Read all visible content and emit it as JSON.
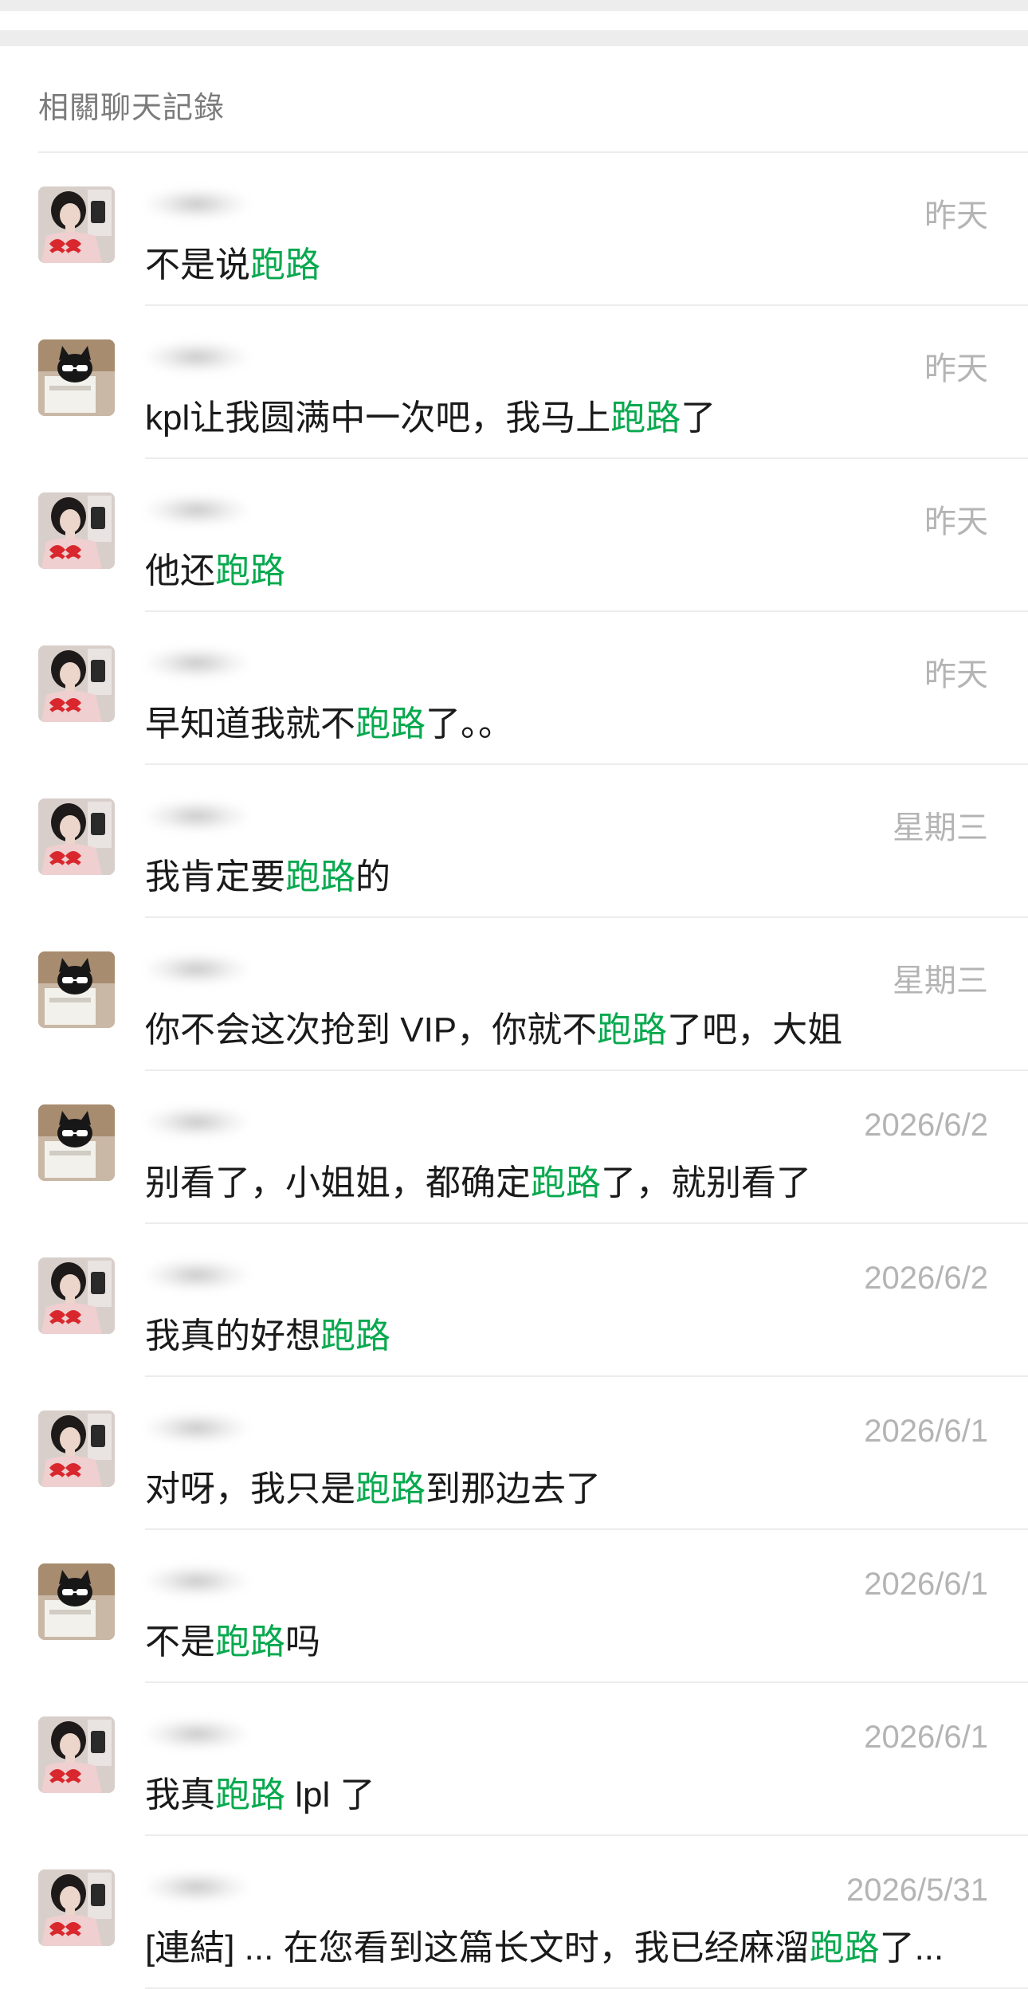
{
  "section": {
    "title": "相關聊天記錄"
  },
  "colors": {
    "highlight": "#07a94e",
    "date": "#b4b4b4",
    "text": "#1a1a1a"
  },
  "items": [
    {
      "avatar": "girl-avatar-icon",
      "date": "昨天",
      "before": "不是说",
      "keyword": "跑路",
      "after": ""
    },
    {
      "avatar": "cat-avatar-icon",
      "date": "昨天",
      "before": "kpl让我圆满中一次吧，我马上",
      "keyword": "跑路",
      "after": "了"
    },
    {
      "avatar": "girl-avatar-icon",
      "date": "昨天",
      "before": "他还",
      "keyword": "跑路",
      "after": ""
    },
    {
      "avatar": "girl-avatar-icon",
      "date": "昨天",
      "before": "早知道我就不",
      "keyword": "跑路",
      "after": "了。。"
    },
    {
      "avatar": "girl-avatar-icon",
      "date": "星期三",
      "before": "我肯定要",
      "keyword": "跑路",
      "after": "的"
    },
    {
      "avatar": "cat-avatar-icon",
      "date": "星期三",
      "before": "你不会这次抢到 VIP，你就不",
      "keyword": "跑路",
      "after": "了吧，大姐"
    },
    {
      "avatar": "cat-avatar-icon",
      "date": "2026/6/2",
      "before": "别看了，小姐姐，都确定",
      "keyword": "跑路",
      "after": "了，就别看了"
    },
    {
      "avatar": "girl-avatar-icon",
      "date": "2026/6/2",
      "before": "我真的好想",
      "keyword": "跑路",
      "after": ""
    },
    {
      "avatar": "girl-avatar-icon",
      "date": "2026/6/1",
      "before": "对呀，我只是",
      "keyword": "跑路",
      "after": "到那边去了"
    },
    {
      "avatar": "cat-avatar-icon",
      "date": "2026/6/1",
      "before": "不是",
      "keyword": "跑路",
      "after": "吗"
    },
    {
      "avatar": "girl-avatar-icon",
      "date": "2026/6/1",
      "before": "我真",
      "keyword": "跑路",
      "after": " lpl 了"
    },
    {
      "avatar": "girl-avatar-icon",
      "date": "2026/5/31",
      "before": "[連結] ... 在您看到这篇长文时，我已经麻溜",
      "keyword": "跑路",
      "after": "了..."
    }
  ]
}
